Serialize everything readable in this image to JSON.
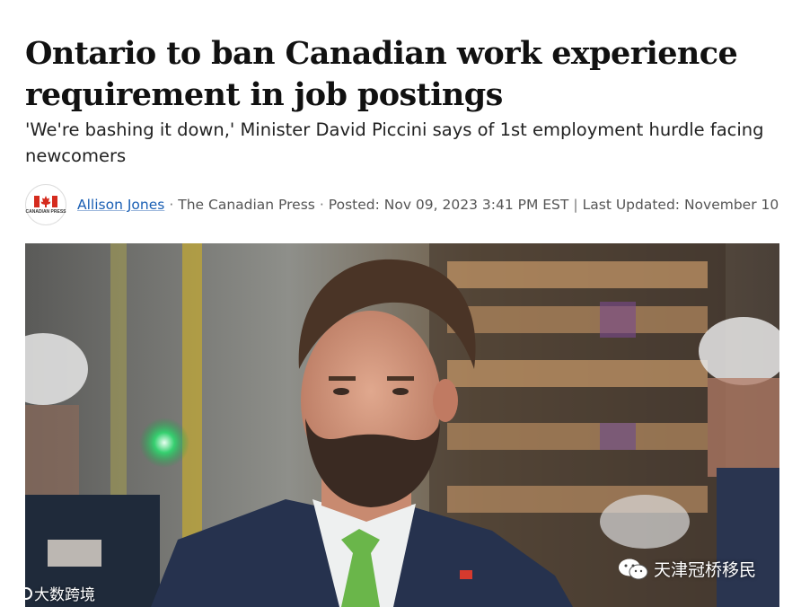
{
  "article": {
    "headline": "Ontario to ban Canadian work experience requirement in job postings",
    "subheadline": "'We're bashing it down,' Minister David Piccini says of 1st employment hurdle facing newcomers"
  },
  "byline": {
    "logo_text": "CANADIAN PRESS",
    "author": "Allison Jones",
    "outlet": "The Canadian Press",
    "posted": "Posted: Nov 09, 2023 3:41 PM EST",
    "updated": "Last Updated: November 10"
  },
  "watermarks": {
    "left": "大数跨境",
    "right": "天津冠桥移民"
  },
  "colors": {
    "author_link": "#1a5fb4",
    "logo_red": "#d52b1e"
  }
}
